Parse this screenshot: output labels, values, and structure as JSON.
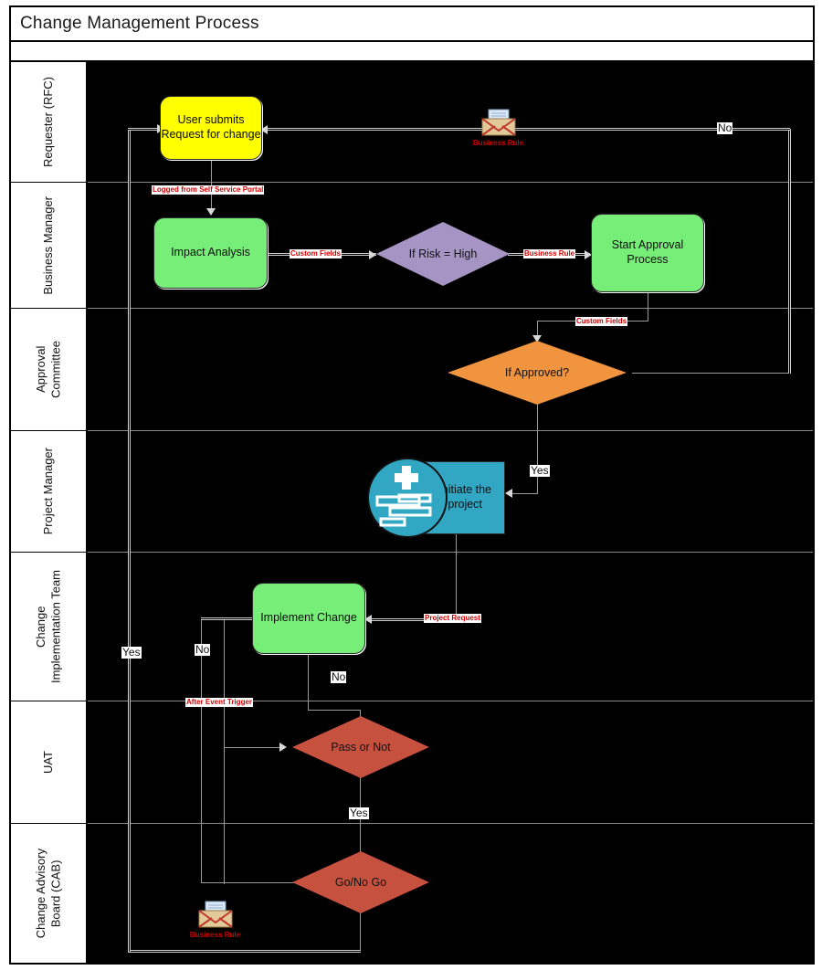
{
  "document": {
    "title": "Change Management Process"
  },
  "lanes": [
    {
      "id": "requester",
      "label": "Requester (RFC)"
    },
    {
      "id": "business",
      "label": "Business Manager"
    },
    {
      "id": "approval",
      "label": "Approval\nCommittee"
    },
    {
      "id": "pm",
      "label": "Project Manager"
    },
    {
      "id": "citeam",
      "label": "Change\nImplementation Team"
    },
    {
      "id": "uat",
      "label": "UAT"
    },
    {
      "id": "cab",
      "label": "Change Advisory\nBoard (CAB)"
    }
  ],
  "nodes": {
    "user_submits": {
      "label": "User submits\nRequest for change",
      "shape": "process",
      "color": "#ffff00",
      "lane": "requester"
    },
    "impact": {
      "label": "Impact Analysis",
      "shape": "process",
      "color": "#77ee77",
      "lane": "business"
    },
    "if_risk": {
      "label": "If Risk = High",
      "shape": "decision",
      "color": "#a695c4",
      "lane": "business"
    },
    "start_approval": {
      "label": "Start Approval\nProcess",
      "shape": "process",
      "color": "#77ee77",
      "lane": "business"
    },
    "if_approved": {
      "label": "If Approved?",
      "shape": "decision",
      "color": "#f0943f",
      "lane": "approval"
    },
    "initiate": {
      "label": "Initiate the\nproject",
      "shape": "rect",
      "color": "#32a7c4",
      "lane": "pm"
    },
    "implement": {
      "label": "Implement Change",
      "shape": "process",
      "color": "#77ee77",
      "lane": "citeam"
    },
    "pass_or_not": {
      "label": "Pass or Not",
      "shape": "decision",
      "color": "#c6513f",
      "lane": "uat"
    },
    "go_no_go": {
      "label": "Go/No Go",
      "shape": "decision",
      "color": "#c6513f",
      "lane": "cab"
    }
  },
  "edge_labels": {
    "logged_portal": "Logged from Self Service Portal",
    "custom_fields1": "Custom Fields",
    "business_rule1": "Business Rule",
    "custom_fields2": "Custom Fields",
    "project_request": "Project Request",
    "after_event": "After Event Trigger"
  },
  "branch_labels": {
    "no_approved": "No",
    "yes_approved": "Yes",
    "yes_pass": "Yes",
    "no_pass": "No",
    "no_go": "No",
    "yes_go": "Yes"
  },
  "annotations": {
    "business_rule_top": "Business Rule",
    "business_rule_bottom": "Business Rule"
  },
  "icons": {
    "envelope_top": "envelope-icon",
    "envelope_bottom": "envelope-icon",
    "project": "project-plus-gantt-icon"
  },
  "colors": {
    "lane_body": "#000000",
    "connector": "#9a9a9a",
    "edge_label_text": "#d40000",
    "frame": "#000000"
  }
}
